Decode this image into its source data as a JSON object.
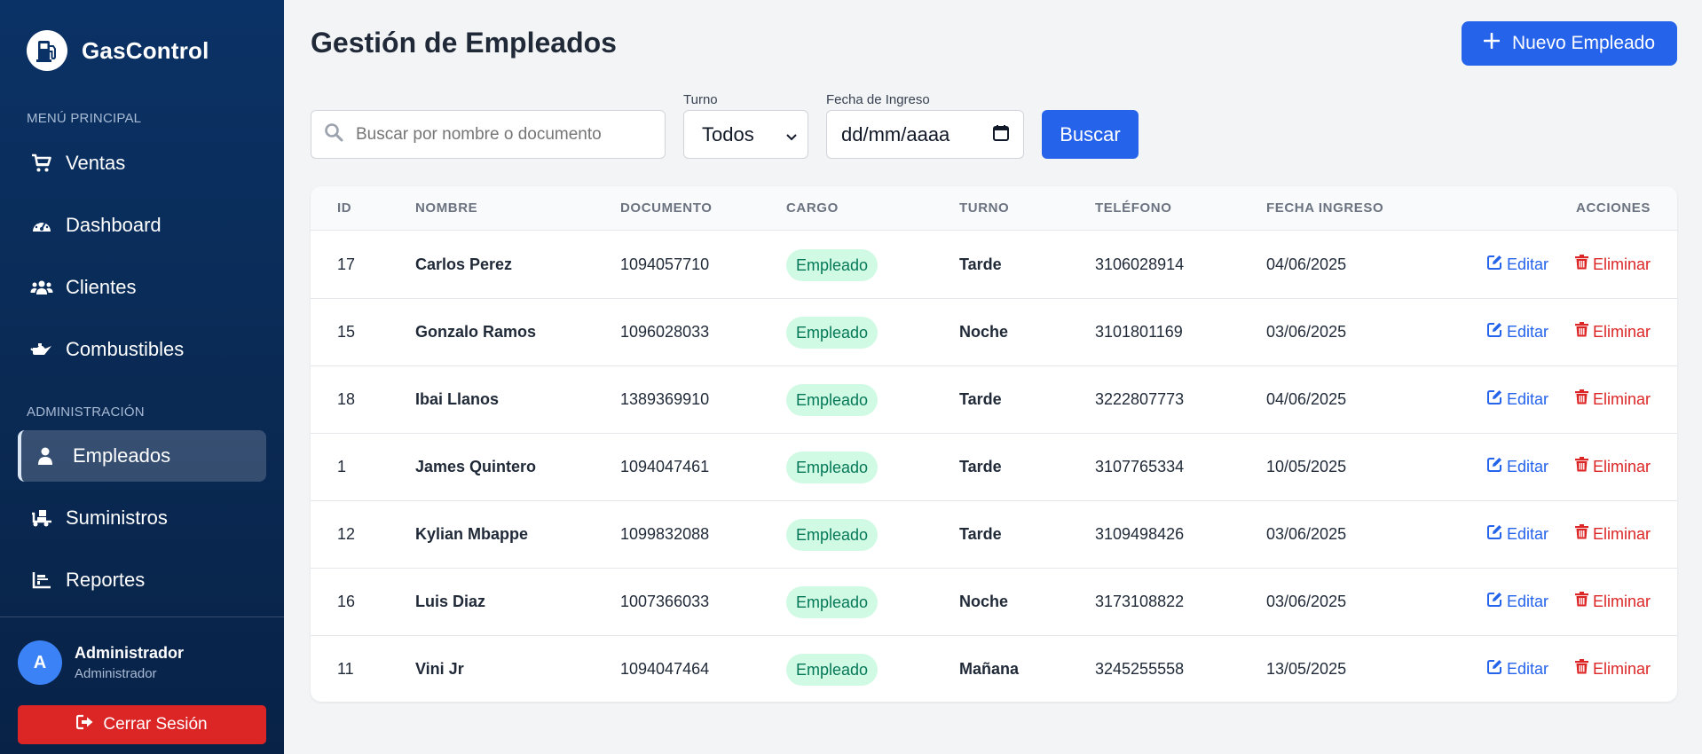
{
  "sidebar": {
    "brand": "GasControl",
    "section_main": "MENÚ PRINCIPAL",
    "section_admin": "ADMINISTRACIÓN",
    "items": [
      {
        "label": "Ventas",
        "icon": "cart-icon"
      },
      {
        "label": "Dashboard",
        "icon": "gauge-icon"
      },
      {
        "label": "Clientes",
        "icon": "users-icon"
      },
      {
        "label": "Combustibles",
        "icon": "oil-can-icon"
      },
      {
        "label": "Empleados",
        "icon": "user-icon",
        "active": true
      },
      {
        "label": "Suministros",
        "icon": "truck-loading-icon"
      },
      {
        "label": "Reportes",
        "icon": "chart-icon"
      }
    ],
    "user": {
      "initial": "A",
      "name": "Administrador",
      "role": "Administrador"
    },
    "logout_label": "Cerrar Sesión"
  },
  "header": {
    "title": "Gestión de Empleados",
    "new_button": "Nuevo Empleado"
  },
  "filters": {
    "search_placeholder": "Buscar por nombre o documento",
    "turno_label": "Turno",
    "turno_value": "Todos",
    "fecha_label": "Fecha de Ingreso",
    "fecha_value": "dd/mm/aaaa",
    "search_button": "Buscar"
  },
  "table": {
    "columns": [
      "ID",
      "NOMBRE",
      "DOCUMENTO",
      "CARGO",
      "TURNO",
      "TELÉFONO",
      "FECHA INGRESO",
      "ACCIONES"
    ],
    "edit_label": "Editar",
    "delete_label": "Eliminar",
    "rows": [
      {
        "id": "17",
        "nombre": "Carlos Perez",
        "documento": "1094057710",
        "cargo": "Empleado",
        "turno": "Tarde",
        "telefono": "3106028914",
        "fecha": "04/06/2025"
      },
      {
        "id": "15",
        "nombre": "Gonzalo Ramos",
        "documento": "1096028033",
        "cargo": "Empleado",
        "turno": "Noche",
        "telefono": "3101801169",
        "fecha": "03/06/2025"
      },
      {
        "id": "18",
        "nombre": "Ibai Llanos",
        "documento": "1389369910",
        "cargo": "Empleado",
        "turno": "Tarde",
        "telefono": "3222807773",
        "fecha": "04/06/2025"
      },
      {
        "id": "1",
        "nombre": "James Quintero",
        "documento": "1094047461",
        "cargo": "Empleado",
        "turno": "Tarde",
        "telefono": "3107765334",
        "fecha": "10/05/2025"
      },
      {
        "id": "12",
        "nombre": "Kylian Mbappe",
        "documento": "1099832088",
        "cargo": "Empleado",
        "turno": "Tarde",
        "telefono": "3109498426",
        "fecha": "03/06/2025"
      },
      {
        "id": "16",
        "nombre": "Luis Diaz",
        "documento": "1007366033",
        "cargo": "Empleado",
        "turno": "Noche",
        "telefono": "3173108822",
        "fecha": "03/06/2025"
      },
      {
        "id": "11",
        "nombre": "Vini Jr",
        "documento": "1094047464",
        "cargo": "Empleado",
        "turno": "Mañana",
        "telefono": "3245255558",
        "fecha": "13/05/2025"
      }
    ]
  },
  "colors": {
    "sidebar_bg": "#0a2b56",
    "primary": "#2563eb",
    "danger": "#dc2626",
    "badge_bg": "#d1fae5",
    "badge_text": "#047857"
  }
}
